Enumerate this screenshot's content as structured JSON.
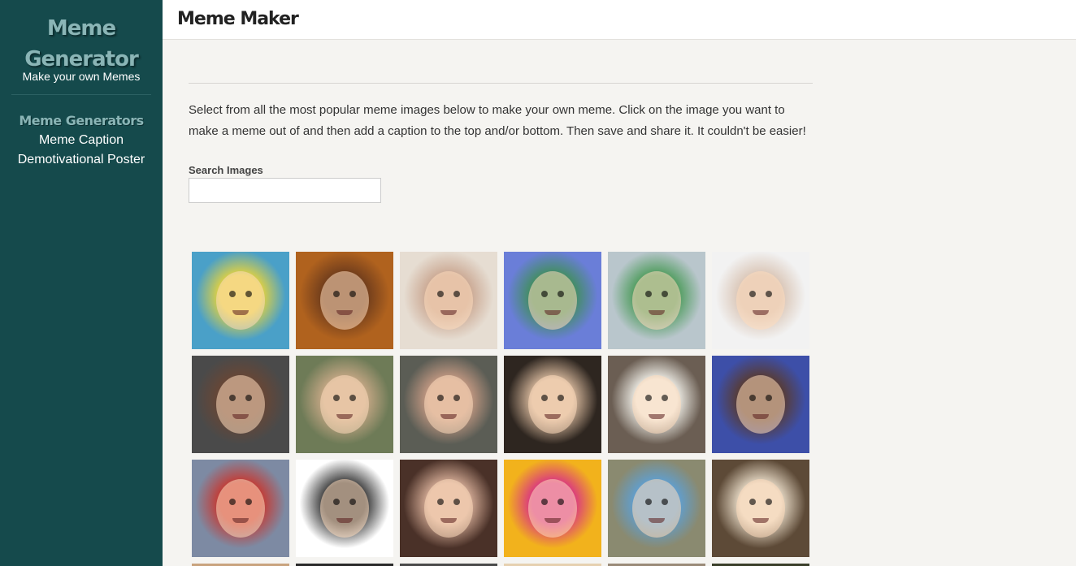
{
  "sidebar": {
    "logo_line1": "Meme",
    "logo_line2": "Generator",
    "tagline": "Make your own Memes",
    "nav_title": "Meme Generators",
    "items": [
      {
        "label": "Meme Caption"
      },
      {
        "label": "Demotivational Poster"
      }
    ]
  },
  "header": {
    "title": "Meme Maker"
  },
  "main": {
    "intro": "Select from all the most popular meme images below to make your own meme. Click on the image you want to make a meme out of and then add a caption to the top and/or bottom. Then save and share it. It couldn't be easier!",
    "search": {
      "label": "Search Images",
      "value": "",
      "placeholder": ""
    }
  },
  "thumbnails": [
    {
      "icon": "spongebob-meme-image",
      "bg": "#4aa0c8",
      "accent": "#e8d33a"
    },
    {
      "icon": "one-does-not-simply-meme-image",
      "bg": "#b0621e",
      "accent": "#6b3a1c"
    },
    {
      "icon": "skeptical-baby-meme-image",
      "bg": "#e6ddd2",
      "accent": "#c9a58f"
    },
    {
      "icon": "success-kid-radial-meme-image",
      "bg": "#6a7ed8",
      "accent": "#3f8f57"
    },
    {
      "icon": "success-kid-beach-meme-image",
      "bg": "#b9c6cc",
      "accent": "#4a9a58"
    },
    {
      "icon": "ryan-gosling-meme-image",
      "bg": "#f2f2f2",
      "accent": "#d9c4b4"
    },
    {
      "icon": "mr-t-meme-image",
      "bg": "#4a4a4a",
      "accent": "#6a4634"
    },
    {
      "icon": "dumb-and-dumber-meme-image",
      "bg": "#6e7b57",
      "accent": "#c9a987"
    },
    {
      "icon": "toothless-guys-meme-image",
      "bg": "#5b5d55",
      "accent": "#c79b84"
    },
    {
      "icon": "most-interesting-man-meme-image",
      "bg": "#2e2620",
      "accent": "#d7b89c"
    },
    {
      "icon": "skeptical-third-world-kid-meme-image",
      "bg": "#6b5e53",
      "accent": "#f0efe8"
    },
    {
      "icon": "jimmy-mcmillan-meme-image",
      "bg": "#3d4fa8",
      "accent": "#5a3a2a"
    },
    {
      "icon": "buddy-christ-meme-image",
      "bg": "#7d8aa3",
      "accent": "#c9362d"
    },
    {
      "icon": "table-flip-rage-comic-image",
      "bg": "#ffffff",
      "accent": "#333333"
    },
    {
      "icon": "first-world-problems-meme-image",
      "bg": "#4a3128",
      "accent": "#d7ae98"
    },
    {
      "icon": "all-the-things-meme-image",
      "bg": "#f2b21c",
      "accent": "#d82f88"
    },
    {
      "icon": "toy-story-everywhere-meme-image",
      "bg": "#8a8a70",
      "accent": "#5da0d6"
    },
    {
      "icon": "polar-bear-facepalm-meme-image",
      "bg": "#5d4a37",
      "accent": "#e9dcc8"
    }
  ],
  "partial_row_colors": [
    "#c9a37e",
    "#2a2a2a",
    "#4a4a4a",
    "#e6d0b0",
    "#9a8a78",
    "#3a3f2a"
  ]
}
